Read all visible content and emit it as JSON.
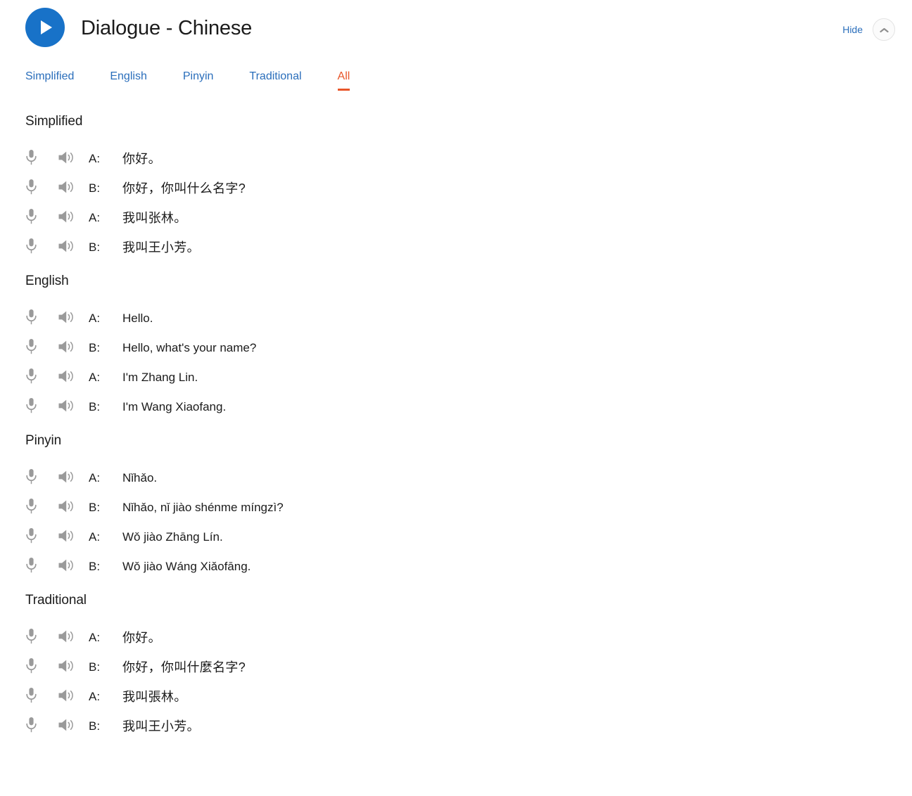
{
  "header": {
    "title": "Dialogue - Chinese",
    "play_icon": "play-icon",
    "hide_label": "Hide",
    "collapse_icon": "chevron-up-icon"
  },
  "colors": {
    "accent_blue": "#1872c8",
    "link_blue": "#2a6ebb",
    "active_orange": "#e8562a",
    "icon_gray": "#9a9a9a",
    "text": "#1b1b1b"
  },
  "tabs": [
    {
      "label": "Simplified",
      "active": false
    },
    {
      "label": "English",
      "active": false
    },
    {
      "label": "Pinyin",
      "active": false
    },
    {
      "label": "Traditional",
      "active": false
    },
    {
      "label": "All",
      "active": true
    }
  ],
  "row_icons": {
    "mic": "microphone-icon",
    "speaker": "speaker-icon"
  },
  "sections": [
    {
      "heading": "Simplified",
      "script": "cjk",
      "lines": [
        {
          "speaker": "A:",
          "text": "你好。"
        },
        {
          "speaker": "B:",
          "text": "你好，你叫什么名字?"
        },
        {
          "speaker": "A:",
          "text": "我叫张林。"
        },
        {
          "speaker": "B:",
          "text": "我叫王小芳。"
        }
      ]
    },
    {
      "heading": "English",
      "script": "latin",
      "lines": [
        {
          "speaker": "A:",
          "text": "Hello."
        },
        {
          "speaker": "B:",
          "text": "Hello, what's your name?"
        },
        {
          "speaker": "A:",
          "text": "I'm Zhang Lin."
        },
        {
          "speaker": "B:",
          "text": "I'm Wang Xiaofang."
        }
      ]
    },
    {
      "heading": "Pinyin",
      "script": "latin",
      "lines": [
        {
          "speaker": "A:",
          "text": "Nǐhǎo."
        },
        {
          "speaker": "B:",
          "text": "Nǐhǎo, nǐ jiào shénme míngzì?"
        },
        {
          "speaker": "A:",
          "text": "Wǒ jiào Zhāng Lín."
        },
        {
          "speaker": "B:",
          "text": "Wǒ jiào Wáng Xiǎofāng."
        }
      ]
    },
    {
      "heading": "Traditional",
      "script": "cjk",
      "lines": [
        {
          "speaker": "A:",
          "text": "你好。"
        },
        {
          "speaker": "B:",
          "text": "你好，你叫什麼名字?"
        },
        {
          "speaker": "A:",
          "text": "我叫張林。"
        },
        {
          "speaker": "B:",
          "text": "我叫王小芳。"
        }
      ]
    }
  ]
}
